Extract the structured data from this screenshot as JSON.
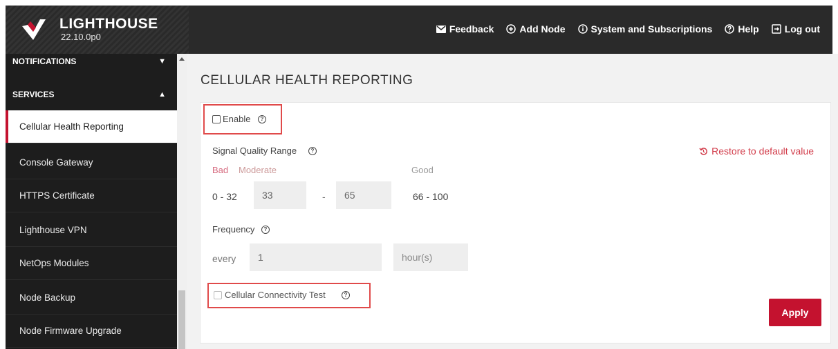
{
  "header": {
    "brand": "LIGHTHOUSE",
    "version": "22.10.0p0",
    "nav": [
      {
        "label": "Feedback",
        "icon": "mail-icon"
      },
      {
        "label": "Add Node",
        "icon": "plus-circle-icon"
      },
      {
        "label": "System and Subscriptions",
        "icon": "info-circle-icon"
      },
      {
        "label": "Help",
        "icon": "question-circle-icon"
      },
      {
        "label": "Log out",
        "icon": "logout-icon"
      }
    ]
  },
  "sidebar": {
    "sections": [
      {
        "label": "NOTIFICATIONS",
        "state": "collapsed"
      },
      {
        "label": "SERVICES",
        "state": "expanded"
      }
    ],
    "items": [
      {
        "label": "Cellular Health Reporting",
        "active": true
      },
      {
        "label": "Console Gateway"
      },
      {
        "label": "HTTPS Certificate"
      },
      {
        "label": "Lighthouse VPN"
      },
      {
        "label": "NetOps Modules"
      },
      {
        "label": "Node Backup"
      },
      {
        "label": "Node Firmware Upgrade"
      }
    ]
  },
  "main": {
    "title": "CELLULAR HEALTH REPORTING",
    "enable_label": "Enable",
    "signal_range_label": "Signal Quality Range",
    "restore_label": "Restore to default value",
    "bad_label": "Bad",
    "moderate_label": "Moderate",
    "good_label": "Good",
    "bad_range": "0 - 32",
    "moderate_low": "33",
    "range_separator": "-",
    "moderate_high": "65",
    "good_range": "66 - 100",
    "frequency_label": "Frequency",
    "every_label": "every",
    "frequency_value": "1",
    "frequency_unit": "hour(s)",
    "connectivity_test_label": "Cellular Connectivity Test",
    "apply_label": "Apply"
  },
  "colors": {
    "accent": "#c4122f",
    "header_bg": "#2a2a2a",
    "sidebar_bg": "#1d1d1d",
    "highlight_box": "#e04a4a"
  }
}
